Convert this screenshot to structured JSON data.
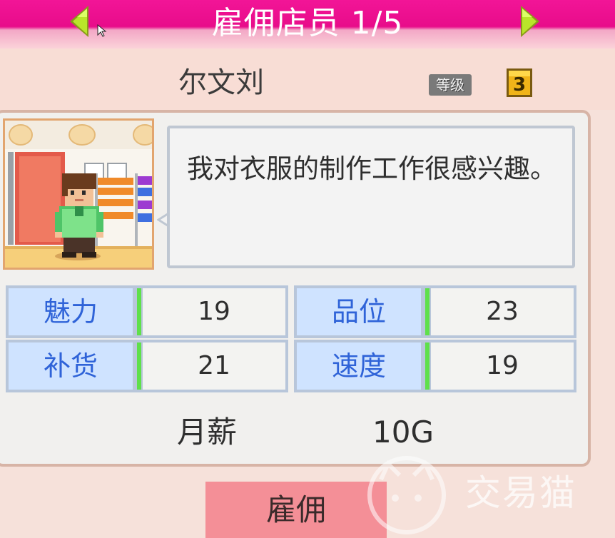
{
  "header": {
    "title": "雇佣店员 1/5",
    "prev_icon": "green-left-arrow-icon",
    "next_icon": "green-right-arrow-icon"
  },
  "staff": {
    "name": "尔文刘",
    "level_label": "等级",
    "level_value": "3",
    "speech": "我对衣服的制作工作很感兴趣。"
  },
  "stats": [
    {
      "label": "魅力",
      "value": "19"
    },
    {
      "label": "品位",
      "value": "23"
    },
    {
      "label": "补货",
      "value": "21"
    },
    {
      "label": "速度",
      "value": "19"
    }
  ],
  "salary": {
    "label": "月薪",
    "value": "10G"
  },
  "actions": {
    "hire_label": "雇佣"
  },
  "watermark": {
    "text": "交易猫"
  },
  "colors": {
    "header": "#e80c8a",
    "stat_label_bg": "#cfe3ff",
    "stat_label_text": "#2f63d8",
    "stat_bar": "#5fe04a",
    "hire_button": "#f48f97"
  }
}
